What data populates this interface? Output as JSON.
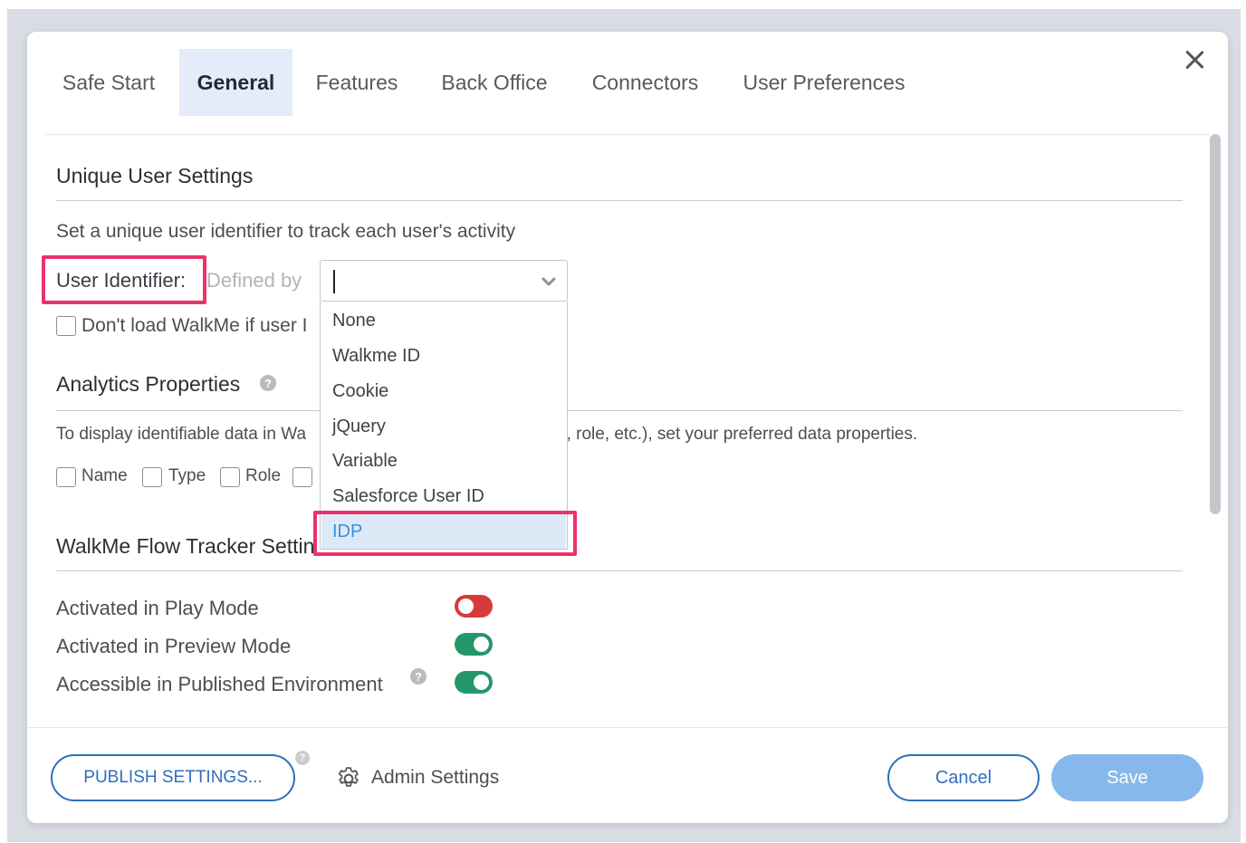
{
  "tabs": [
    {
      "label": "Safe Start",
      "active": false
    },
    {
      "label": "General",
      "active": true
    },
    {
      "label": "Features",
      "active": false
    },
    {
      "label": "Back Office",
      "active": false
    },
    {
      "label": "Connectors",
      "active": false
    },
    {
      "label": "User Preferences",
      "active": false
    }
  ],
  "unique_user": {
    "title": "Unique User Settings",
    "description": "Set a unique user identifier to track each user's activity",
    "identifier_label": "User Identifier:",
    "defined_by": "Defined by",
    "select_value": "",
    "dont_load_label": "Don't load WalkMe if user I",
    "options": [
      "None",
      "Walkme ID",
      "Cookie",
      "jQuery",
      "Variable",
      "Salesforce User ID",
      "IDP"
    ],
    "highlighted_option": "IDP"
  },
  "analytics": {
    "title": "Analytics Properties",
    "help_icon": "?",
    "description_left": "To display identifiable data in Wa",
    "description_right": "e, role, etc.), set your preferred data properties.",
    "checkboxes": [
      "Name",
      "Type",
      "Role"
    ]
  },
  "flow_tracker": {
    "title_visible": "WalkMe Flow Tracker Settin",
    "rows": [
      {
        "label": "Activated in Play Mode",
        "state": "off"
      },
      {
        "label": "Activated in Preview Mode",
        "state": "on"
      },
      {
        "label": "Accessible in Published Environment",
        "state": "on",
        "help_icon": "?"
      }
    ]
  },
  "footer": {
    "publish_label": "PUBLISH SETTINGS...",
    "help_icon": "?",
    "admin_settings_label": "Admin Settings",
    "cancel_label": "Cancel",
    "save_label": "Save"
  },
  "colors": {
    "accent": "#2f6fbf",
    "highlight": "#ea3368",
    "toggle_on": "#23976a",
    "toggle_off": "#d63a3a",
    "save_disabled": "#86b8ec"
  }
}
